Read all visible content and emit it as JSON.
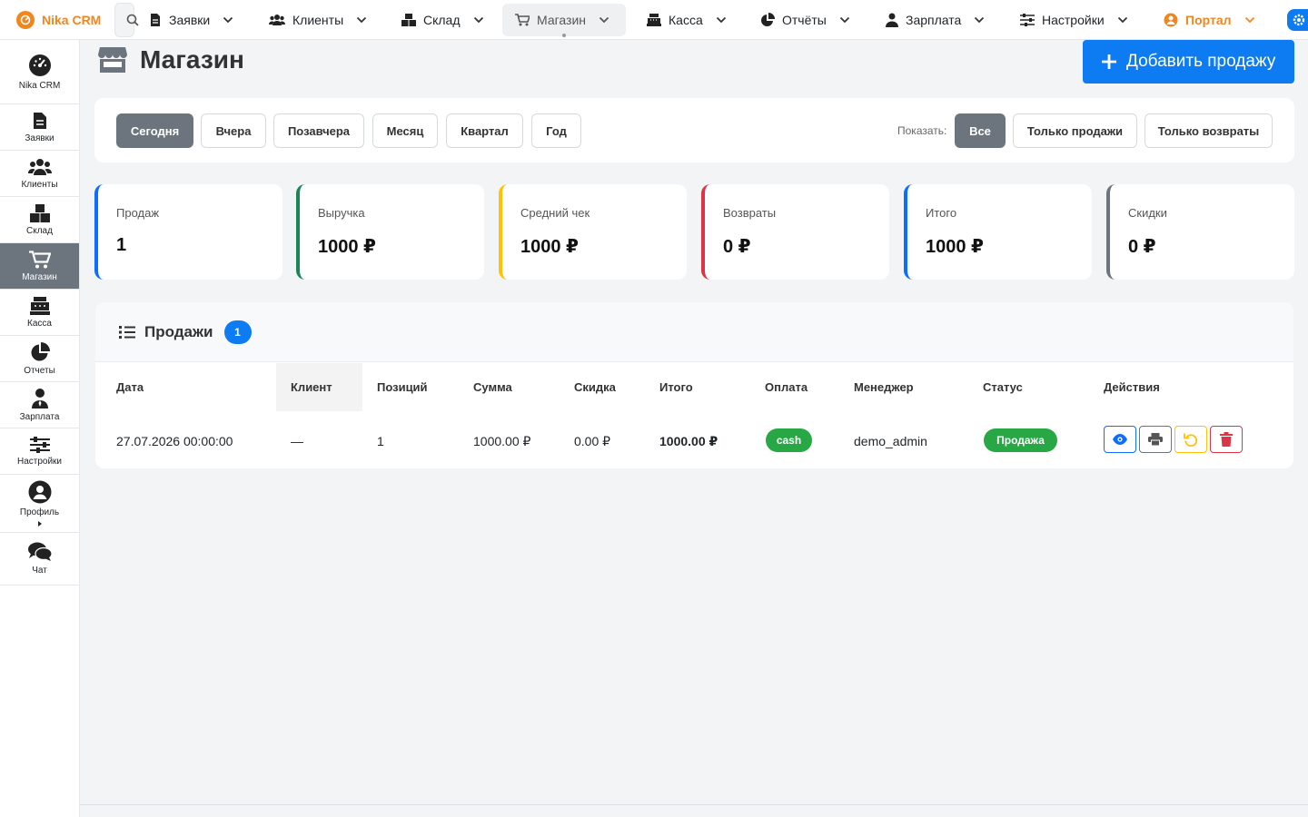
{
  "topnav": {
    "brand": "Nika CRM",
    "items": [
      {
        "label": "Заявки",
        "icon": "file-icon"
      },
      {
        "label": "Клиенты",
        "icon": "users-icon"
      },
      {
        "label": "Склад",
        "icon": "boxes-icon"
      },
      {
        "label": "Магазин",
        "icon": "cart-icon"
      },
      {
        "label": "Касса",
        "icon": "cash-register-icon"
      },
      {
        "label": "Отчёты",
        "icon": "pie-chart-icon"
      },
      {
        "label": "Зарплата",
        "icon": "user-tie-icon"
      },
      {
        "label": "Настройки",
        "icon": "sliders-icon"
      },
      {
        "label": "Портал",
        "icon": "user-circle-icon"
      }
    ]
  },
  "sidebar": {
    "items": [
      {
        "label": "Nika CRM",
        "icon": "dashboard-icon"
      },
      {
        "label": "Заявки",
        "icon": "file-icon"
      },
      {
        "label": "Клиенты",
        "icon": "users-icon"
      },
      {
        "label": "Склад",
        "icon": "boxes-icon"
      },
      {
        "label": "Магазин",
        "icon": "cart-icon"
      },
      {
        "label": "Касса",
        "icon": "cash-register-icon"
      },
      {
        "label": "Отчеты",
        "icon": "pie-chart-icon"
      },
      {
        "label": "Зарплата",
        "icon": "user-tie-icon"
      },
      {
        "label": "Настройки",
        "icon": "sliders-icon"
      },
      {
        "label": "Профиль",
        "icon": "user-circle-icon"
      },
      {
        "label": "Чат",
        "icon": "comments-icon"
      }
    ]
  },
  "page": {
    "title": "Магазин",
    "add_button": "Добавить продажу"
  },
  "filters": {
    "periods": [
      "Сегодня",
      "Вчера",
      "Позавчера",
      "Месяц",
      "Квартал",
      "Год"
    ],
    "show_label": "Показать:",
    "types": [
      "Все",
      "Только продажи",
      "Только возвраты"
    ]
  },
  "stats": [
    {
      "label": "Продаж",
      "value": "1",
      "color": "#0d6efd"
    },
    {
      "label": "Выручка",
      "value": "1000 ₽",
      "color": "#198754"
    },
    {
      "label": "Средний чек",
      "value": "1000 ₽",
      "color": "#ffc107"
    },
    {
      "label": "Возвраты",
      "value": "0 ₽",
      "color": "#dc3545"
    },
    {
      "label": "Итого",
      "value": "1000 ₽",
      "color": "#0d6efd"
    },
    {
      "label": "Скидки",
      "value": "0 ₽",
      "color": "#6c757d"
    }
  ],
  "sales": {
    "title": "Продажи",
    "count": "1",
    "columns": [
      "Дата",
      "Клиент",
      "Позиций",
      "Сумма",
      "Скидка",
      "Итого",
      "Оплата",
      "Менеджер",
      "Статус",
      "Действия"
    ],
    "rows": [
      {
        "date": "27.07.2026 00:00:00",
        "client": "—",
        "positions": "1",
        "sum": "1000.00 ₽",
        "discount": "0.00 ₽",
        "total": "1000.00 ₽",
        "payment": "cash",
        "manager": "demo_admin",
        "status": "Продажа"
      }
    ]
  }
}
